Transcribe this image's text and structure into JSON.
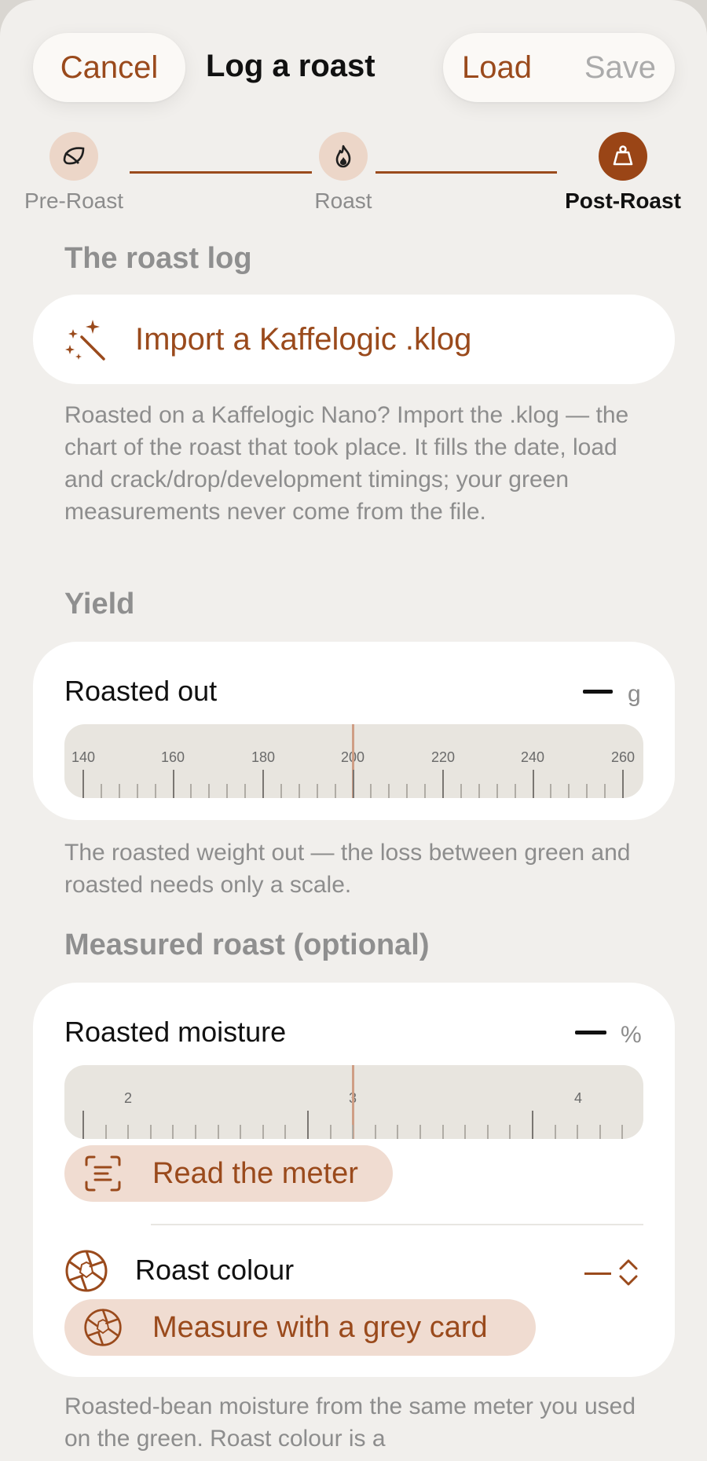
{
  "nav": {
    "cancel": "Cancel",
    "title": "Log a roast",
    "load": "Load",
    "save": "Save"
  },
  "stepper": {
    "steps": [
      {
        "label": "Pre-Roast",
        "icon": "leaf-icon",
        "active": false
      },
      {
        "label": "Roast",
        "icon": "flame-icon",
        "active": false
      },
      {
        "label": "Post-Roast",
        "icon": "weight-icon",
        "active": true
      }
    ]
  },
  "roast_log": {
    "section_title": "The roast log",
    "import_label": "Import a Kaffelogic .klog",
    "import_icon": "magic-wand-icon",
    "help": "Roasted on a Kaffelogic Nano? Import the .klog — the chart of the roast that took place. It fills the date, load and crack/drop/development timings; your green measurements never come from the file."
  },
  "yield": {
    "section_title": "Yield",
    "roasted_out_label": "Roasted out",
    "unit": "g",
    "ruler_labels": [
      "140",
      "160",
      "180",
      "200",
      "220",
      "240",
      "260"
    ],
    "help": "The roasted weight out — the loss between green and roasted needs only a scale."
  },
  "measured": {
    "section_title": "Measured roast (optional)",
    "moisture_label": "Roasted moisture",
    "moisture_unit": "%",
    "moisture_ruler_labels": [
      "2",
      "3",
      "4"
    ],
    "read_meter": "Read the meter",
    "roast_colour_label": "Roast colour",
    "grey_card": "Measure with a grey card",
    "help": "Roasted-bean moisture from the same meter you used on the green. Roast colour is a"
  },
  "colors": {
    "accent": "#9a4a1c",
    "accent_soft": "#f0dcd1",
    "background": "#f1efec",
    "card": "#ffffff"
  }
}
